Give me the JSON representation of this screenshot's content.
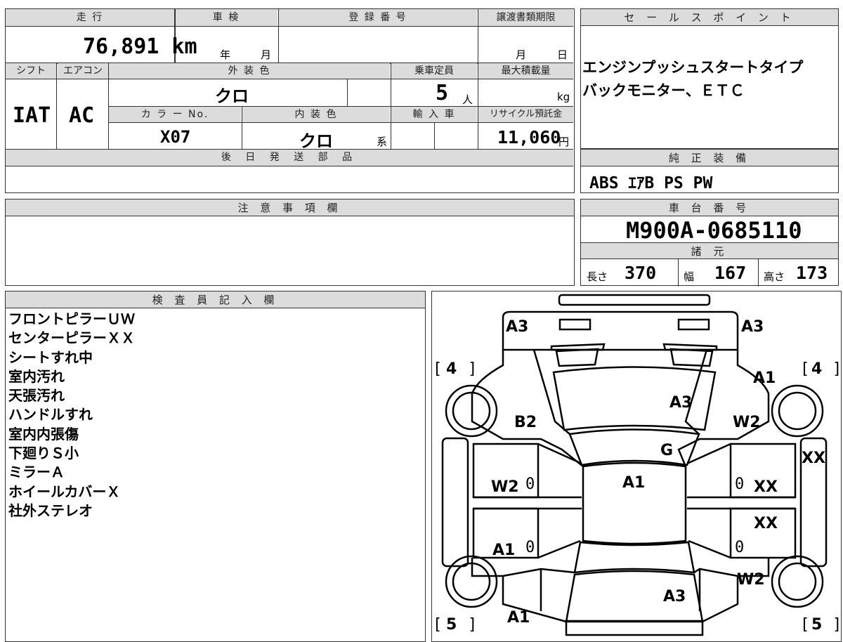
{
  "vehicle": {
    "mileage_header": "走 行",
    "mileage_value": "76,891 km",
    "inspection_header": "車 検",
    "inspection_year": "年",
    "inspection_month": "月",
    "registration_header": "登 録 番 号",
    "transfer_deadline_header": "譲渡書類期限",
    "transfer_month": "月",
    "transfer_day": "日",
    "shift_header": "シフト",
    "shift_value": "IAT",
    "aircon_header": "エアコン",
    "aircon_value": "AC",
    "exterior_color_header": "外 装 色",
    "exterior_color_value": "クロ",
    "capacity_header": "乗車定員",
    "capacity_value": "5",
    "capacity_unit": "人",
    "max_load_header": "最大積載量",
    "max_load_unit": "kg",
    "color_no_header": "カ ラ ー No.",
    "color_no_value": "X07",
    "interior_color_header": "内 装 色",
    "interior_color_value": "クロ",
    "interior_color_suffix": "系",
    "import_header": "輸 入 車",
    "recycle_header": "リサイクル預託金",
    "recycle_value": "11,060",
    "recycle_unit": "円",
    "later_parts_header": "後 日 発 送 部 品"
  },
  "sales_points": {
    "header": "セ ー ル ス ポ イ ン ト",
    "lines": [
      "エンジンプッシュスタートタイプ",
      "バックモニター、ＥＴＣ"
    ]
  },
  "genuine_equipment": {
    "header": "純 正 装 備",
    "value": "ABS ｴｱB PS PW"
  },
  "cautions": {
    "header": "注 意 事 項 欄"
  },
  "chassis": {
    "header": "車 台 番 号",
    "value": "M900A-0685110",
    "specs_header": "諸 元",
    "length_label": "長さ",
    "length_value": "370",
    "width_label": "幅",
    "width_value": "167",
    "height_label": "高さ",
    "height_value": "173"
  },
  "inspector": {
    "header": "検 査 員 記 入 欄",
    "notes": [
      "フロントピラーＵＷ",
      "センターピラーＸＸ",
      "シートすれ中",
      "室内汚れ",
      "天張汚れ",
      "ハンドルすれ",
      "室内内張傷",
      "下廻りＳ小",
      "ミラーＡ",
      "ホイールカバーＸ",
      "社外ステレオ"
    ]
  },
  "diagram": {
    "labels": {
      "front_left": "A3",
      "front_right": "A3",
      "hood": "A3",
      "windshield": "G",
      "roof": "A1",
      "right_front_fender": "A1",
      "left_front_fender": "B2",
      "right_front_wheel": "W2",
      "left_front_door": "W2",
      "left_rear_door": "A1",
      "right_front_door": "XX",
      "right_rear_door": "XX",
      "right_side_panel": "XX",
      "right_rear_wheel": "W2",
      "rear_gate": "A3",
      "rear_left": "A1",
      "zero_1": "0",
      "zero_2": "0",
      "zero_3": "0",
      "zero_4": "0",
      "tire_fl": "4",
      "tire_fr": "4",
      "tire_rl": "5",
      "tire_rr": "5"
    }
  }
}
